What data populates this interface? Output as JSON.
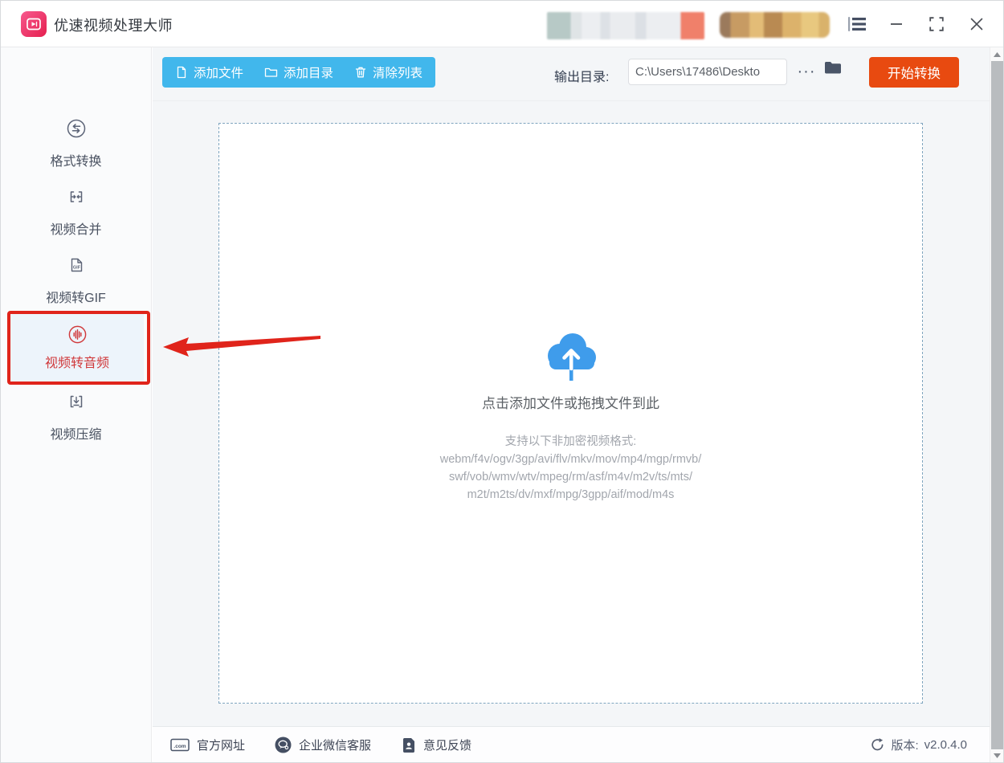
{
  "window": {
    "title": "优速视频处理大师"
  },
  "sidebar": {
    "active_index": 3,
    "items": [
      {
        "label": "格式转换"
      },
      {
        "label": "视频合并"
      },
      {
        "label": "视频转GIF"
      },
      {
        "label": "视频转音频"
      },
      {
        "label": "视频压缩"
      }
    ]
  },
  "toolbar": {
    "add_file_label": "添加文件",
    "add_folder_label": "添加目录",
    "clear_list_label": "清除列表",
    "output_dir_label": "输出目录:",
    "output_dir_value": "C:\\Users\\17486\\Deskto",
    "more_label": "···",
    "start_label": "开始转换"
  },
  "dropzone": {
    "hint": "点击添加文件或拖拽文件到此",
    "formats_title": "支持以下非加密视频格式:",
    "formats_lines": [
      "webm/f4v/ogv/3gp/avi/flv/mkv/mov/mp4/mgp/rmvb/",
      "swf/vob/wmv/wtv/mpeg/rm/asf/m4v/m2v/ts/mts/",
      "m2t/m2ts/dv/mxf/mpg/3gpp/aif/mod/m4s"
    ]
  },
  "footer": {
    "website_label": "官方网址",
    "wechat_label": "企业微信客服",
    "feedback_label": "意见反馈",
    "version_label": "版本:",
    "version_value": "v2.0.4.0"
  },
  "colors": {
    "accent_blue": "#41b7ec",
    "accent_orange": "#e84a10",
    "annotation_red": "#e0241b",
    "active_item_red": "#d0393b",
    "cloud_blue": "#3f9ceb"
  }
}
